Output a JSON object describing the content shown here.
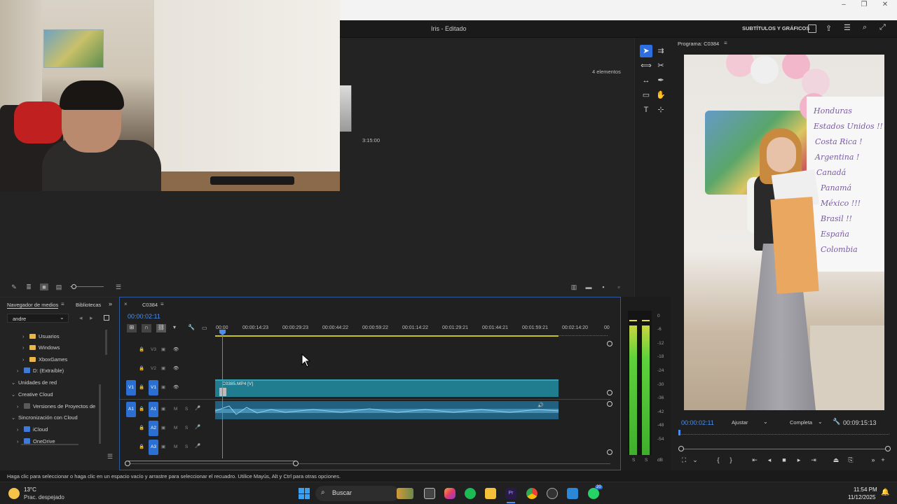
{
  "window": {
    "title": "Iris - Editado",
    "workspace_label": "SUBTÍTULOS Y GRÁFICOS"
  },
  "project_panel": {
    "items_count": "4 elementos",
    "clip_duration": "3:15:00"
  },
  "program_monitor": {
    "title": "Programa: C0384",
    "current_timecode": "00:00:02:11",
    "fit_select": "Ajustar",
    "quality_select": "Completa",
    "duration_timecode": "00:09:15:13",
    "whiteboard_text": [
      "Honduras",
      "Estados Unidos !!",
      "Costa Rica !",
      "Argentina !",
      "Canadá",
      "Panamá",
      "México !!!",
      "Brasil !!",
      "España",
      "Colombia"
    ]
  },
  "media_browser": {
    "tab_navigator": "Navegador de medios",
    "tab_libraries": "Bibliotecas",
    "user_select": "andre",
    "tree": [
      {
        "label": "Usuarios",
        "type": "folder",
        "level": 2
      },
      {
        "label": "Windows",
        "type": "folder",
        "level": 2
      },
      {
        "label": "XboxGames",
        "type": "folder",
        "level": 2
      },
      {
        "label": "D: (Extraíble)",
        "type": "drive",
        "level": 1
      },
      {
        "label": "Unidades de red",
        "type": "section",
        "level": 0
      },
      {
        "label": "Creative Cloud",
        "type": "section",
        "level": 0
      },
      {
        "label": "Versiones de Proyectos de",
        "type": "drive",
        "level": 1
      },
      {
        "label": "Sincronización con Cloud",
        "type": "section",
        "level": 0
      },
      {
        "label": "iCloud",
        "type": "drive",
        "level": 1
      },
      {
        "label": "OneDrive",
        "type": "drive",
        "level": 1
      }
    ]
  },
  "timeline": {
    "sequence_name": "C0384",
    "current_timecode": "00:00:02:11",
    "ruler": [
      "00:00",
      "00:00:14:23",
      "00:00:29:23",
      "00:00:44:22",
      "00:00:59:22",
      "00:01:14:22",
      "00:01:29:21",
      "00:01:44:21",
      "00:01:59:21",
      "00:02:14:20",
      "00"
    ],
    "video_tracks": [
      "V3",
      "V2",
      "V1"
    ],
    "audio_tracks": [
      "A1",
      "A2",
      "A3"
    ],
    "source_v": "V1",
    "source_a": "A1",
    "mute_label": "M",
    "solo_label": "S",
    "video_clip_label": "C0385.MP4 [V]"
  },
  "meters": {
    "db_labels": [
      "0",
      "-6",
      "-12",
      "-18",
      "-24",
      "-30",
      "-36",
      "-42",
      "-48",
      "-54",
      "dB"
    ],
    "channel_labels": [
      "S",
      "S"
    ],
    "level_left": 0.9,
    "level_right": 0.9
  },
  "status_bar": {
    "hint": "Haga clic para seleccionar o haga clic en un espacio vacío y arrastre para seleccionar el recuadro. Utilice Mayús, Alt y Ctrl para otras opciones."
  },
  "taskbar": {
    "weather_temp": "13°C",
    "weather_desc": "Prac. despejado",
    "search_label": "Buscar",
    "time": "11:54 PM",
    "date": "11/12/2025",
    "whatsapp_badge": "20"
  },
  "colors": {
    "accent": "#2b6fd3",
    "timecode": "#4a8ff0",
    "video_clip": "#1f7d8f",
    "audio_clip": "#21607e"
  }
}
